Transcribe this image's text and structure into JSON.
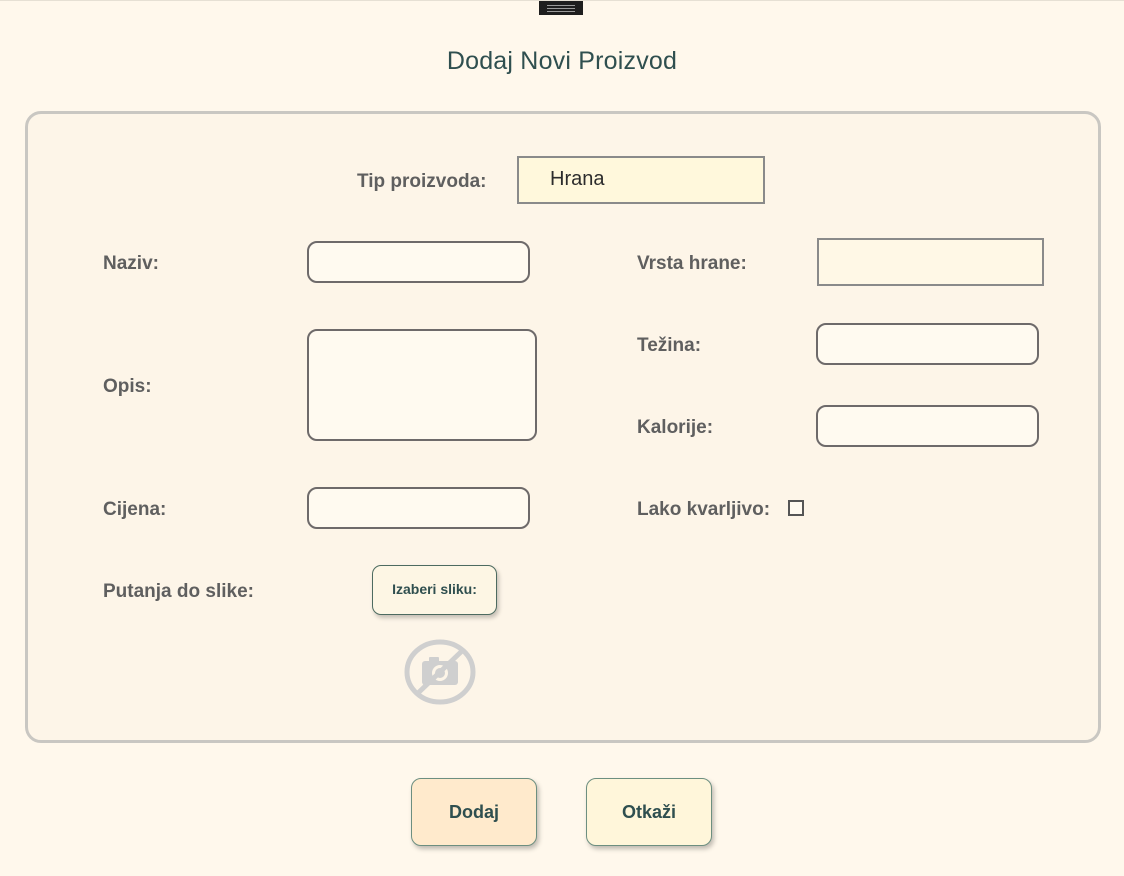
{
  "dialog": {
    "title": "Dodaj Novi Proizvod"
  },
  "form": {
    "product_type_label": "Tip proizvoda:",
    "product_type_value": "Hrana",
    "name_label": "Naziv:",
    "description_label": "Opis:",
    "price_label": "Cijena:",
    "image_path_label": "Putanja do slike:",
    "choose_image_button": "Izaberi sliku:",
    "no_image_icon": "no-image-icon",
    "food_type_label": "Vrsta hrane:",
    "weight_label": "Težina:",
    "calories_label": "Kalorije:",
    "perishable_label": "Lako kvarljivo:",
    "perishable_checked": false
  },
  "actions": {
    "add_label": "Dodaj",
    "cancel_label": "Otkaži"
  },
  "colors": {
    "background": "#fff8ec",
    "title": "#2f4f4f",
    "add_button": "#ffeacc",
    "cancel_button": "#fff6da"
  }
}
